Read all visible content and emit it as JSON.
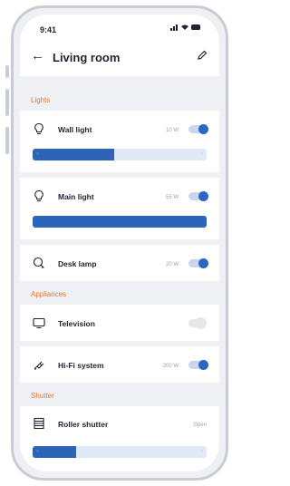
{
  "status_bar": {
    "time": "9:41",
    "icons": "📶 ▬"
  },
  "header": {
    "title": "Living room",
    "back_icon": "arrow-left",
    "edit_icon": "pencil"
  },
  "sections": {
    "lights": "Lights",
    "appliances": "Appliances",
    "shutter": "Shutter"
  },
  "devices": {
    "wall_light": {
      "label": "Wall light",
      "power": "10 W",
      "on": true,
      "level": 0.47
    },
    "main_light": {
      "label": "Main light",
      "power": "55 W",
      "on": true,
      "level": 1.0
    },
    "desk_lamp": {
      "label": "Desk lamp",
      "power": "20 W",
      "on": true
    },
    "television": {
      "label": "Television",
      "on": false
    },
    "hifi": {
      "label": "Hi-Fi system",
      "power": "200 W",
      "on": true
    },
    "roller_shutter": {
      "label": "Roller shutter",
      "state": "Open",
      "level": 0.25
    }
  },
  "colors": {
    "accent": "#2b66c4",
    "section": "#e8772e"
  }
}
